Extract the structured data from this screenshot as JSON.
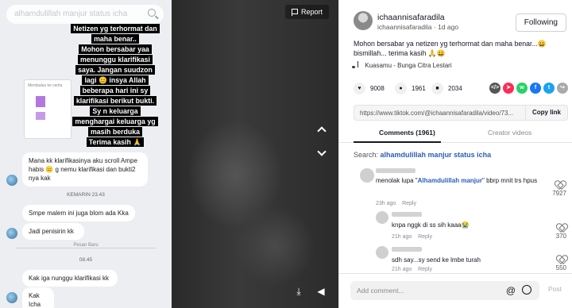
{
  "left_video": {
    "search_text": "alhamdulillah manjur status icha",
    "overlay_lines": [
      "Netizen yg terhormat dan",
      "maha benar..",
      "Mohon bersabar yaa",
      "menunggu klarifikasi",
      "saya. Jangan suudzon",
      "lagi 😊 insya Allah",
      "beberapa hari ini sy",
      "klarifikasi berikut bukti.",
      "Sy n keluarga",
      "menghargai keluarga yg",
      "masih berduka",
      "Terima kasih 🙏"
    ],
    "screenshot_caption": "Membalas ke cerita",
    "msg1": "Mana kk klarifikasinya aku scroll Ampe habis 😑 g nemu klarifikasi dan bukti2 nya kak",
    "time1": "KEMARIN 23.43",
    "msg2": "Smpe malem ini juga blom ada Kka",
    "msg3": "Jadi penisirin kk",
    "divider": "Pesan Baru",
    "time2": "08.45",
    "msg4": "Kak iga nunggu klarifikasi kk",
    "msg5": "Kak Icha"
  },
  "mid_video": {
    "report_label": "Report"
  },
  "panel": {
    "author_name": "ichaannisafaradila",
    "author_handle": "ichaannisafaradila",
    "post_age": "· 1d ago",
    "follow_label": "Following",
    "description": "Mohon bersabar ya netizen yg terhormat dan maha benar...😀 bismillah... terima kasih 🙏😀",
    "music": "Kuasamu - Bunga Citra Lestari",
    "likes": "9008",
    "comments_count": "1961",
    "saves": "2034",
    "link_url": "https://www.tiktok.com/@ichaannisafaradila/video/73...",
    "copy_label": "Copy link",
    "tab_comments": "Comments (1961)",
    "tab_creator": "Creator videos",
    "search_prefix": "Search:",
    "search_query": "alhamdulillah manjur status icha",
    "comments": [
      {
        "pre": "menolak lupa \"",
        "highlight": "Alhamdulillah manjur",
        "post": "\" bbrp mnit trs hpus",
        "age": "23h ago",
        "reply": "Reply",
        "likes": "7927"
      },
      {
        "pre": "knpa nggk di ss sih kaaa😭",
        "highlight": "",
        "post": "",
        "age": "21h ago",
        "reply": "Reply",
        "likes": "370"
      },
      {
        "pre": "sdh say...sy send ke lmbe turah",
        "highlight": "",
        "post": "",
        "age": "21h ago",
        "reply": "Reply",
        "likes": "550"
      }
    ],
    "add_placeholder": "Add comment...",
    "post_label": "Post",
    "at_symbol": "@"
  },
  "colors": {
    "link_blue": "#2b5db8",
    "text_dark": "#161823"
  }
}
